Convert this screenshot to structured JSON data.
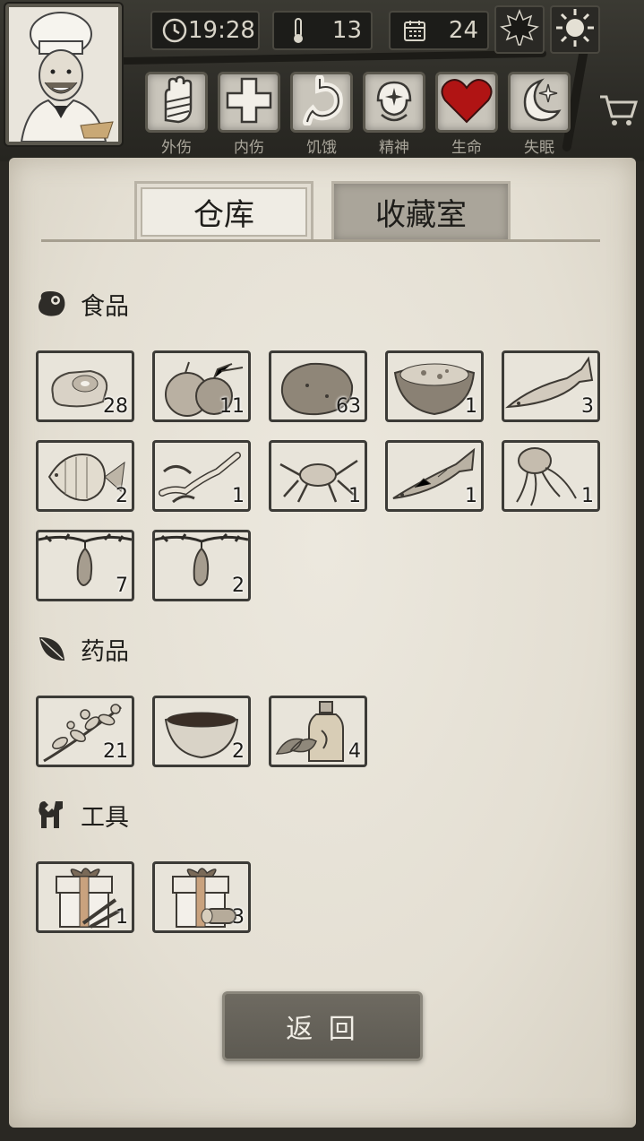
{
  "stats": {
    "time": "19:28",
    "temperature": "13",
    "day": "24",
    "season_icon": "maple-leaf-icon",
    "weather_icon": "sun-icon"
  },
  "status_bars": [
    {
      "label": "外伤",
      "icon": "bandaged-hand-icon"
    },
    {
      "label": "内伤",
      "icon": "cross-icon"
    },
    {
      "label": "饥饿",
      "icon": "stomach-icon"
    },
    {
      "label": "精神",
      "icon": "head-sparkle-icon"
    },
    {
      "label": "生命",
      "icon": "heart-icon",
      "color": "#b01414"
    },
    {
      "label": "失眠",
      "icon": "moon-star-icon"
    }
  ],
  "tabs": {
    "warehouse": "仓库",
    "collection": "收藏室"
  },
  "sections": {
    "food": {
      "title": "食品",
      "items": [
        {
          "icon": "meat-icon",
          "count": "28"
        },
        {
          "icon": "onion-icon",
          "count": "11"
        },
        {
          "icon": "potato-icon",
          "count": "63"
        },
        {
          "icon": "coconut-bowl-icon",
          "count": "1"
        },
        {
          "icon": "salmon-icon",
          "count": "3"
        },
        {
          "icon": "butterflyfish-icon",
          "count": "2"
        },
        {
          "icon": "lobster-icon",
          "count": "1"
        },
        {
          "icon": "crab-icon",
          "count": "1"
        },
        {
          "icon": "cod-icon",
          "count": "1"
        },
        {
          "icon": "jellyfish-icon",
          "count": "1"
        },
        {
          "icon": "hanging-fruit-icon",
          "count": "7"
        },
        {
          "icon": "hanging-fruit-icon",
          "count": "2"
        }
      ]
    },
    "medicine": {
      "title": "药品",
      "items": [
        {
          "icon": "herb-branch-icon",
          "count": "21"
        },
        {
          "icon": "tea-bowl-icon",
          "count": "2"
        },
        {
          "icon": "medicine-bottle-icon",
          "count": "4"
        }
      ]
    },
    "tools": {
      "title": "工具",
      "items": [
        {
          "icon": "tool-gift-box-icon",
          "count": "1"
        },
        {
          "icon": "tool-gift-box-log-icon",
          "count": "3"
        }
      ]
    }
  },
  "back_button": "返 回",
  "colors": {
    "panel": "#e8e4da",
    "slot_border": "#3c3b37",
    "button": "#625f57"
  }
}
